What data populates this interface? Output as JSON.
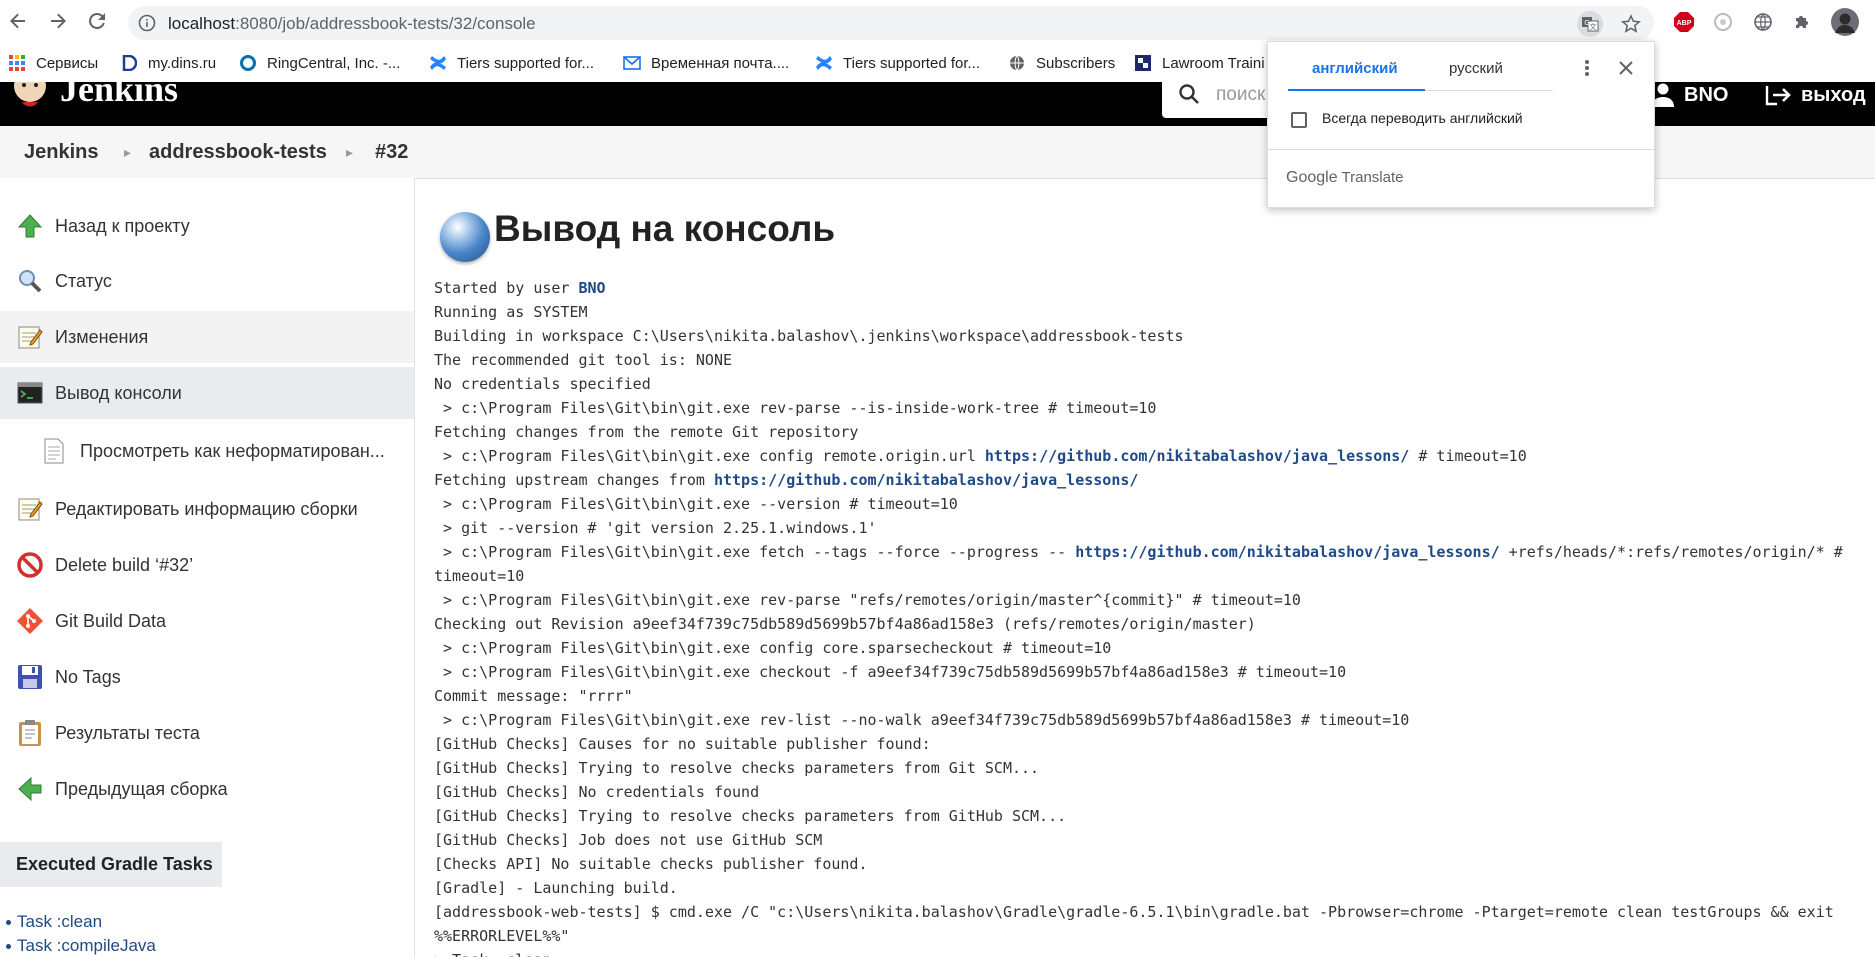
{
  "browser": {
    "url_host": "localhost",
    "url_rest": ":8080/job/addressbook-tests/32/console",
    "icons": [
      "back-icon",
      "forward-icon",
      "reload-icon",
      "info-icon",
      "translate-icon",
      "star-icon",
      "abp-icon",
      "extension-icon",
      "globe-icon",
      "puzzle-icon",
      "profile-avatar"
    ],
    "abp_label": "ABP"
  },
  "bookmarks": [
    {
      "label": "Сервисы",
      "icon": "apps-icon"
    },
    {
      "label": "my.dins.ru",
      "icon": "dins-icon"
    },
    {
      "label": "RingCentral, Inc. -...",
      "icon": "ringcentral-icon"
    },
    {
      "label": "Tiers supported for...",
      "icon": "confluence-icon"
    },
    {
      "label": "Временная почта....",
      "icon": "mail-icon"
    },
    {
      "label": "Tiers supported for...",
      "icon": "confluence-icon"
    },
    {
      "label": "Subscribers",
      "icon": "globe-icon"
    },
    {
      "label": "Lawroom Traini",
      "icon": "lawroom-icon"
    }
  ],
  "jenkins_header": {
    "logo": "Jenkins",
    "search_placeholder": "поиск",
    "user": "BNO",
    "logout": "выход"
  },
  "breadcrumbs": [
    "Jenkins",
    "addressbook-tests",
    "#32"
  ],
  "sidebar": {
    "items": [
      {
        "label": "Назад к проекту",
        "icon": "up-arrow-icon"
      },
      {
        "label": "Статус",
        "icon": "magnifier-icon"
      },
      {
        "label": "Изменения",
        "icon": "notepad-icon"
      },
      {
        "label": "Вывод консоли",
        "icon": "terminal-icon"
      },
      {
        "label": "Просмотреть как неформатирован...",
        "icon": "document-icon"
      },
      {
        "label": "Редактировать информацию сборки",
        "icon": "notepad-icon"
      },
      {
        "label": "Delete build ‘#32’",
        "icon": "no-entry-icon"
      },
      {
        "label": "Git Build Data",
        "icon": "git-icon"
      },
      {
        "label": "No Tags",
        "icon": "floppy-icon"
      },
      {
        "label": "Результаты теста",
        "icon": "clipboard-icon"
      },
      {
        "label": "Предыдущая сборка",
        "icon": "left-arrow-icon"
      }
    ],
    "gradle_title": "Executed Gradle Tasks",
    "gradle_tasks": [
      "Task :clean",
      "Task :compileJava"
    ]
  },
  "main": {
    "title": "Вывод на консоль",
    "console": [
      [
        {
          "t": "Started by user "
        },
        {
          "t": "BNO",
          "link": true
        }
      ],
      [
        {
          "t": "Running as SYSTEM"
        }
      ],
      [
        {
          "t": "Building in workspace C:\\Users\\nikita.balashov\\.jenkins\\workspace\\addressbook-tests"
        }
      ],
      [
        {
          "t": "The recommended git tool is: NONE"
        }
      ],
      [
        {
          "t": "No credentials specified"
        }
      ],
      [
        {
          "t": " > c:\\Program Files\\Git\\bin\\git.exe rev-parse --is-inside-work-tree # timeout=10"
        }
      ],
      [
        {
          "t": "Fetching changes from the remote Git repository"
        }
      ],
      [
        {
          "t": " > c:\\Program Files\\Git\\bin\\git.exe config remote.origin.url "
        },
        {
          "t": "https://github.com/nikitabalashov/java_lessons/",
          "link": true
        },
        {
          "t": " # timeout=10"
        }
      ],
      [
        {
          "t": "Fetching upstream changes from "
        },
        {
          "t": "https://github.com/nikitabalashov/java_lessons/",
          "link": true
        }
      ],
      [
        {
          "t": " > c:\\Program Files\\Git\\bin\\git.exe --version # timeout=10"
        }
      ],
      [
        {
          "t": " > git --version # 'git version 2.25.1.windows.1'"
        }
      ],
      [
        {
          "t": " > c:\\Program Files\\Git\\bin\\git.exe fetch --tags --force --progress -- "
        },
        {
          "t": "https://github.com/nikitabalashov/java_lessons/",
          "link": true
        },
        {
          "t": " +refs/heads/*:refs/remotes/origin/* #"
        }
      ],
      [
        {
          "t": "timeout=10"
        }
      ],
      [
        {
          "t": " > c:\\Program Files\\Git\\bin\\git.exe rev-parse \"refs/remotes/origin/master^{commit}\" # timeout=10"
        }
      ],
      [
        {
          "t": "Checking out Revision a9eef34f739c75db589d5699b57bf4a86ad158e3 (refs/remotes/origin/master)"
        }
      ],
      [
        {
          "t": " > c:\\Program Files\\Git\\bin\\git.exe config core.sparsecheckout # timeout=10"
        }
      ],
      [
        {
          "t": " > c:\\Program Files\\Git\\bin\\git.exe checkout -f a9eef34f739c75db589d5699b57bf4a86ad158e3 # timeout=10"
        }
      ],
      [
        {
          "t": "Commit message: \"rrrr\""
        }
      ],
      [
        {
          "t": " > c:\\Program Files\\Git\\bin\\git.exe rev-list --no-walk a9eef34f739c75db589d5699b57bf4a86ad158e3 # timeout=10"
        }
      ],
      [
        {
          "t": "[GitHub Checks] Causes for no suitable publisher found:"
        }
      ],
      [
        {
          "t": "[GitHub Checks] Trying to resolve checks parameters from Git SCM..."
        }
      ],
      [
        {
          "t": "[GitHub Checks] No credentials found"
        }
      ],
      [
        {
          "t": "[GitHub Checks] Trying to resolve checks parameters from GitHub SCM..."
        }
      ],
      [
        {
          "t": "[GitHub Checks] Job does not use GitHub SCM"
        }
      ],
      [
        {
          "t": "[Checks API] No suitable checks publisher found."
        }
      ],
      [
        {
          "t": "[Gradle] - Launching build."
        }
      ],
      [
        {
          "t": "[addressbook-web-tests] $ cmd.exe /C \"c:\\Users\\nikita.balashov\\Gradle\\gradle-6.5.1\\bin\\gradle.bat -Pbrowser=chrome -Ptarget=remote clean testGroups && exit"
        }
      ],
      [
        {
          "t": "%%ERRORLEVEL%%\""
        }
      ],
      [
        {
          "t": "> Task :clean"
        }
      ]
    ]
  },
  "translate_popup": {
    "tab_source": "английский",
    "tab_target": "русский",
    "always_translate": "Всегда переводить английский",
    "brand_google": "Google",
    "brand_translate": "Translate"
  }
}
